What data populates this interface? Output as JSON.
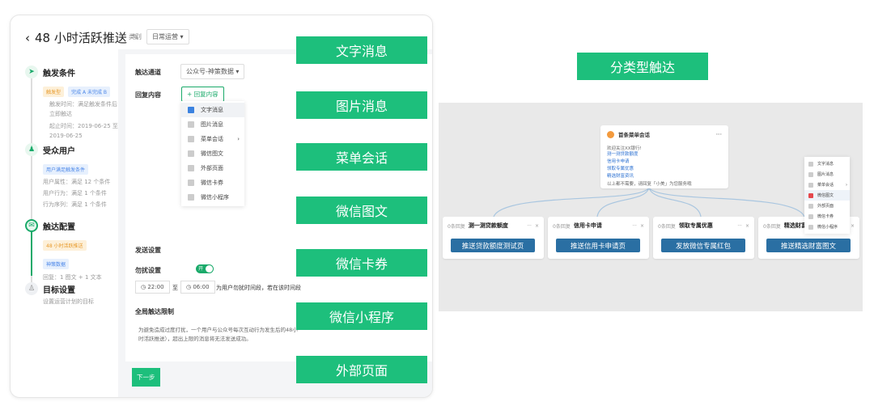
{
  "left": {
    "back": "‹",
    "title": "48 小时活跃推送",
    "category_label": "类别",
    "category_value": "日常运营",
    "steps": [
      {
        "title": "触发条件",
        "tags": [
          "触发型",
          "完成 A 未完成 B"
        ],
        "lines": [
          "触发时间：满足触发条件后立即触达",
          "起止时间：2019-06-25 至 2019-06-25"
        ]
      },
      {
        "title": "受众用户",
        "tags": [
          "用户满足触发条件"
        ],
        "lines": [
          "用户属性：满足 12 个条件",
          "用户行为：满足 1 个条件",
          "行为序列：满足 1 个条件"
        ]
      },
      {
        "title": "触达配置",
        "tags": [
          "48 小时活跃推送",
          "神策数据"
        ],
        "lines": [
          "回复：1 图文 + 1 文本"
        ]
      },
      {
        "title": "目标设置",
        "lines": [
          "设置运营计划的目标"
        ]
      }
    ],
    "channel_label": "触达通道",
    "channel_value": "公众号-神策数据",
    "reply_label": "回复内容",
    "reply_button": "+ 回复内容",
    "menu": [
      "文字消息",
      "图片消息",
      "菜单会话",
      "微信图文",
      "外部页面",
      "微信卡券",
      "微信小程序"
    ],
    "send_settings": "发送设置",
    "dnd_label": "勿扰设置",
    "toggle_text": "开",
    "time_from": "22:00",
    "to": "至",
    "time_to": "06:00",
    "dnd_desc": "为用户勿扰时间段，若在该时间段",
    "global_label": "全局触达限制",
    "global_desc": "为避免造成过度打扰，一个用户与公众号每次互动行为发生后的48小时活跃推送），超出上限的消息将无法发送成功。",
    "next": "下一步"
  },
  "labels": [
    "文字消息",
    "图片消息",
    "菜单会话",
    "微信图文",
    "微信卡券",
    "微信小程序",
    "外部页面"
  ],
  "right": {
    "title": "分类型触达",
    "root": {
      "title": "首条菜单会话",
      "more": "···",
      "intro": "欢迎关注XX银行!",
      "links": [
        "测一测贷款额度",
        "信用卡申请",
        "领取专属优惠",
        "精选财富资讯"
      ],
      "footer": "以上都不需要，请回复「小美」为您服务哦"
    },
    "children": [
      {
        "badge": "0条回复",
        "title": "测一测贷款额度",
        "button": "推送贷款额度测试页"
      },
      {
        "badge": "0条回复",
        "title": "信用卡申请",
        "button": "推送信用卡申请页"
      },
      {
        "badge": "0条回复",
        "title": "领取专属优惠",
        "button": "发放微信专属红包"
      },
      {
        "badge": "0条回复",
        "title": "精选财富资讯",
        "button": "推送精选财富图文"
      }
    ],
    "menu": [
      "文字消息",
      "图片消息",
      "菜单会话",
      "微信图文",
      "外部页面",
      "微信卡券",
      "微信小程序"
    ],
    "more": "···",
    "close": "×"
  }
}
